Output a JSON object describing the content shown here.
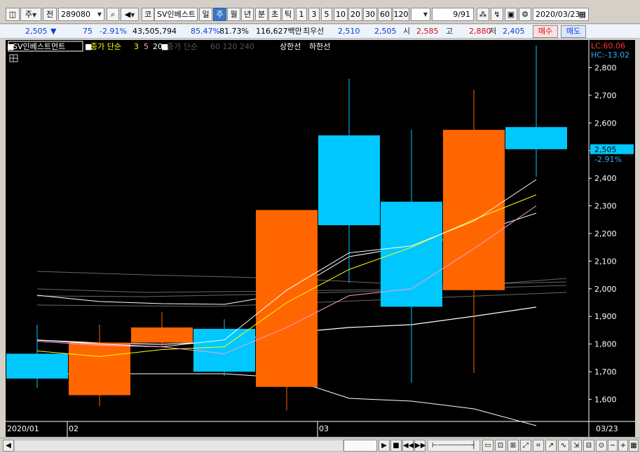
{
  "toolbar": {
    "type_label": "주",
    "prev_label": "전",
    "code": "289080",
    "market_label": "코",
    "name": "SV인베스트",
    "periods": [
      "일",
      "주",
      "월",
      "년"
    ],
    "intraday": [
      "분",
      "초",
      "틱"
    ],
    "ranges": [
      "1",
      "3",
      "5",
      "10",
      "20",
      "30",
      "60",
      "120"
    ],
    "page": "9/91",
    "date": "2020/03/23"
  },
  "quote": {
    "price": "2,505",
    "arrow": "▼",
    "change": "75",
    "change_pct": "-2.91%",
    "volume": "43,505,794",
    "ratio1": "85.47%",
    "ratio2": "81.73%",
    "amount": "116,627백만",
    "best_label": "최우선",
    "ask": "2,510",
    "bid": "2,505",
    "open_label": "시",
    "open": "2,585",
    "high_label": "고",
    "high": "2,880",
    "low_label": "저",
    "low": "2,405",
    "buy_label": "매수",
    "sell_label": "매도"
  },
  "legend": {
    "name": "SV인베스트먼트",
    "ma_label": "종가 단순",
    "ma_periods": [
      "3",
      "5",
      "20"
    ],
    "ma_label2": "종가 단순",
    "ma_periods2": [
      "60",
      "120",
      "240"
    ],
    "limit_up": "상한선",
    "limit_down": "하한선"
  },
  "indicators": {
    "lc": "LC:60.06",
    "hc": "HC:-13.02"
  },
  "price_tag": {
    "value": "2,505",
    "pct": "-2.91%"
  },
  "colors": {
    "up": "#ff6600",
    "down": "#00c8ff",
    "ma3": "#ffff00",
    "ma5": "#ffffff",
    "ma20": "#ff99dd",
    "axis_text": "#ffffff",
    "background": "#000000"
  },
  "chart_data": {
    "type": "candlestick",
    "ylim": [
      1525,
      2885
    ],
    "y_ticks": [
      1600,
      1700,
      1800,
      1900,
      2000,
      2100,
      2200,
      2300,
      2400,
      2500,
      2600,
      2700,
      2800
    ],
    "x_labels": [
      "2020/01",
      "02",
      "03",
      "03/23"
    ],
    "candles": [
      {
        "open": 1765,
        "close": 1675,
        "high": 1870,
        "low": 1640
      },
      {
        "open": 1615,
        "close": 1805,
        "high": 1870,
        "low": 1575
      },
      {
        "open": 1805,
        "close": 1860,
        "high": 1915,
        "low": 1790
      },
      {
        "open": 1855,
        "close": 1700,
        "high": 1890,
        "low": 1685
      },
      {
        "open": 1645,
        "close": 2285,
        "high": 2285,
        "low": 1560
      },
      {
        "open": 2555,
        "close": 2230,
        "high": 2760,
        "low": 2020
      },
      {
        "open": 2315,
        "close": 1935,
        "high": 2575,
        "low": 1660
      },
      {
        "open": 1995,
        "close": 2575,
        "high": 2720,
        "low": 1695
      },
      {
        "open": 2585,
        "close": 2505,
        "high": 2880,
        "low": 2405
      }
    ],
    "series": [
      {
        "name": "3",
        "values": [
          1775,
          1755,
          1780,
          1790,
          1950,
          2070,
          2150,
          2250,
          2340
        ]
      },
      {
        "name": "5",
        "values": [
          1815,
          1800,
          1790,
          1815,
          1995,
          2130,
          2155,
          2245,
          2395
        ]
      },
      {
        "name": "20",
        "values": [
          1810,
          1795,
          1790,
          1765,
          1860,
          1975,
          2000,
          2145,
          2300
        ]
      }
    ]
  }
}
